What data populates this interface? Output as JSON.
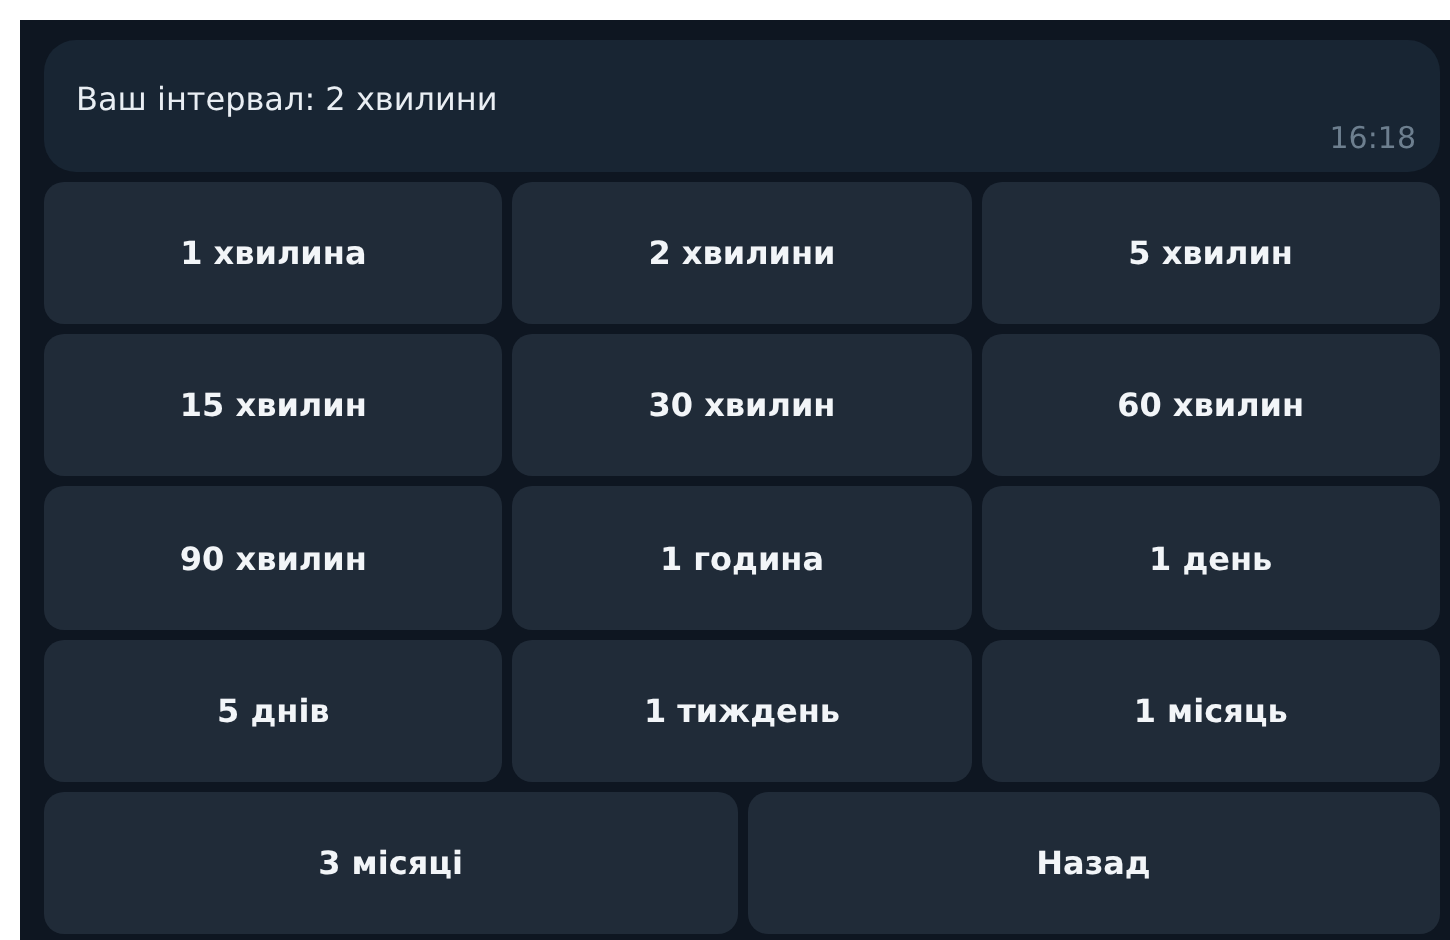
{
  "message": {
    "text": "Ваш інтервал: 2 хвилини",
    "time": "16:18"
  },
  "keyboard": [
    [
      "1 хвилина",
      "2 хвилини",
      "5 хвилин"
    ],
    [
      "15 хвилин",
      "30 хвилин",
      "60 хвилин"
    ],
    [
      "90 хвилин",
      "1 година",
      "1 день"
    ],
    [
      "5 днів",
      "1 тиждень",
      "1 місяць"
    ],
    [
      "3 місяці",
      "Назад"
    ]
  ]
}
